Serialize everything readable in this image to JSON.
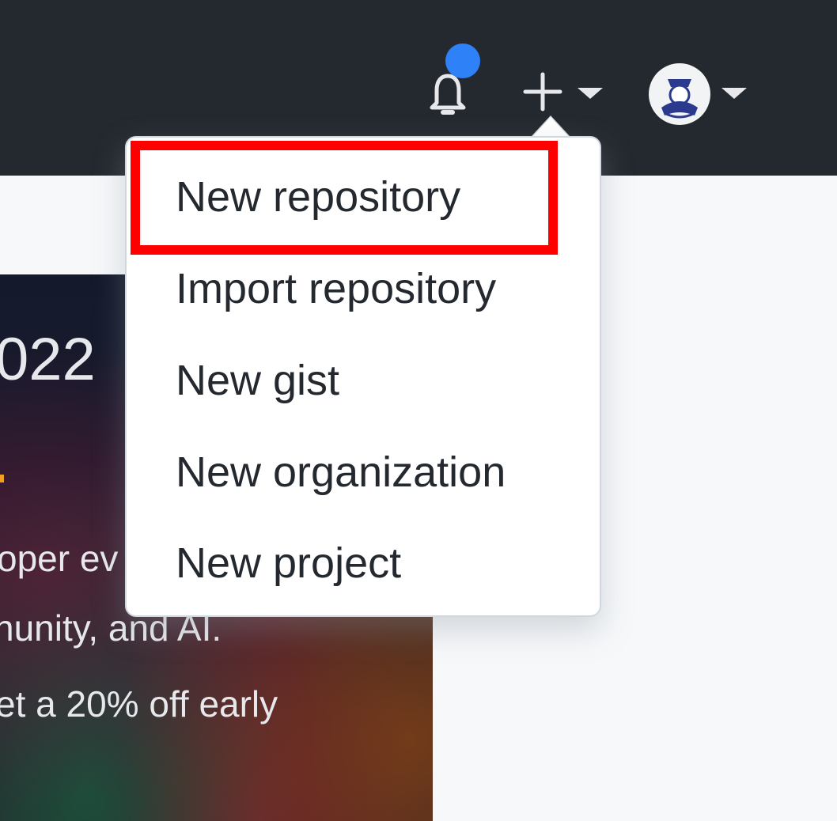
{
  "header": {
    "notifications_icon": "bell-icon",
    "notification_indicator_color": "#2f81f7",
    "create_icon": "plus-icon",
    "create_caret_icon": "caret-down-icon",
    "avatar_icon": "avatar",
    "avatar_caret_icon": "caret-down-icon"
  },
  "create_menu": {
    "items": [
      {
        "label": "New repository"
      },
      {
        "label": "Import repository"
      },
      {
        "label": "New gist"
      },
      {
        "label": "New organization"
      },
      {
        "label": "New project"
      }
    ],
    "highlighted_item": "New repository",
    "highlight_color": "#ff0000"
  },
  "promo": {
    "year_fragment": "022",
    "line1": "oper ev",
    "line2": "nunity, and AI.",
    "line3": "et a 20% off early"
  },
  "colors": {
    "header_bg": "#24292f",
    "page_bg": "#f6f8fa",
    "menu_text": "#24292f"
  }
}
